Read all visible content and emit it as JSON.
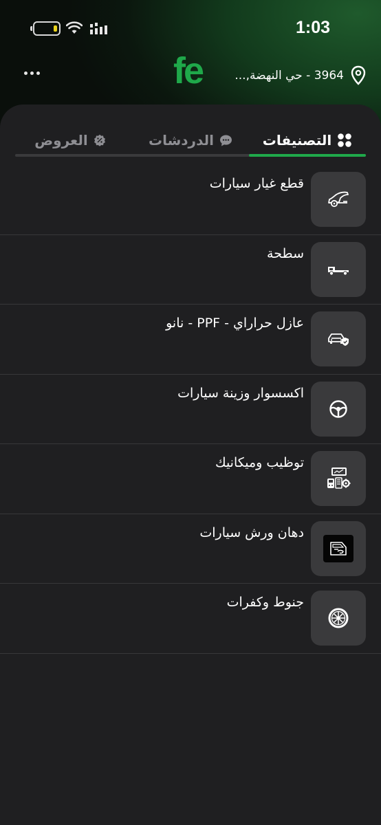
{
  "status_bar": {
    "time": "1:03"
  },
  "header": {
    "logo": "fe",
    "location": "3964 - حي النهضة,..."
  },
  "tabs": [
    {
      "label": "التصنيفات",
      "active": true,
      "icon": "grid-icon"
    },
    {
      "label": "الدردشات",
      "active": false,
      "icon": "chat-bubble-icon"
    },
    {
      "label": "العروض",
      "active": false,
      "icon": "discount-badge-icon"
    }
  ],
  "categories": [
    {
      "label": "قطع غيار سيارات",
      "icon": "car-parts-icon"
    },
    {
      "label": "سطحة",
      "icon": "tow-truck-icon"
    },
    {
      "label": "عازل حراراي - PPF - نانو",
      "icon": "car-shield-icon"
    },
    {
      "label": "اكسسوار  وزينة سيارات",
      "icon": "steering-wheel-icon"
    },
    {
      "label": "توظيب وميكانيك",
      "icon": "diagnostics-icon"
    },
    {
      "label": "دهان ورش سيارات",
      "icon": "car-door-paint-icon"
    },
    {
      "label": "جنوط وكفرات",
      "icon": "wheel-rim-icon"
    }
  ],
  "colors": {
    "accent": "#1fa84a",
    "sheet_background": "#1f1f21",
    "icon_box": "#3a3a3c",
    "battery_level": "#e8d21b"
  }
}
